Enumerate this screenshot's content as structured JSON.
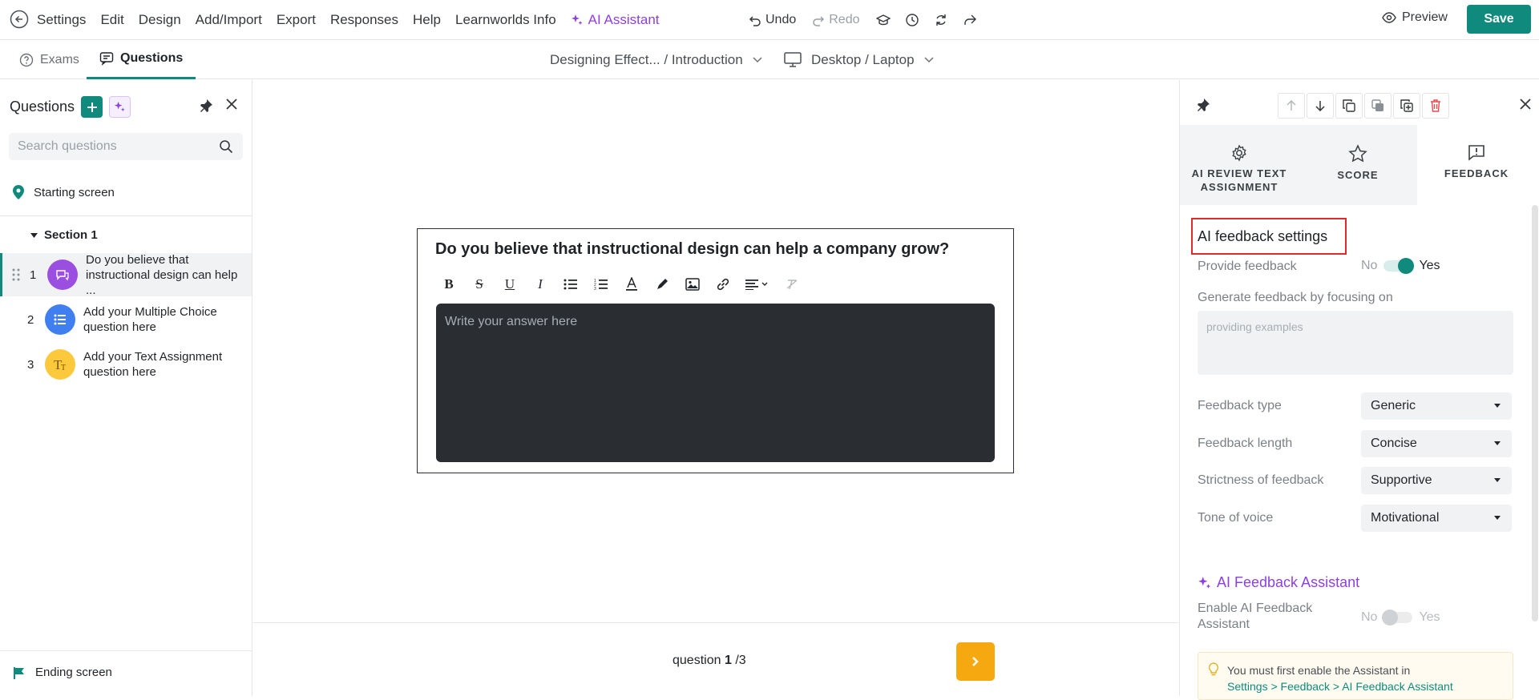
{
  "menu": {
    "items": [
      "Settings",
      "Edit",
      "Design",
      "Add/Import",
      "Export",
      "Responses",
      "Help",
      "Learnworlds Info"
    ],
    "ai_assistant": "AI Assistant"
  },
  "history": {
    "undo": "Undo",
    "redo": "Redo"
  },
  "header": {
    "preview": "Preview",
    "save": "Save"
  },
  "tabs": {
    "exams": "Exams",
    "questions": "Questions"
  },
  "breadcrumb": {
    "path": "Designing Effect... / Introduction",
    "device": "Desktop / Laptop"
  },
  "sidebar": {
    "title": "Questions",
    "search_placeholder": "Search questions",
    "starting_screen": "Starting screen",
    "section": "Section 1",
    "questions": [
      {
        "num": "1",
        "text": "Do you believe that instructional design can help ...",
        "color": "#9b4fe0",
        "icon": "text-assignment-icon"
      },
      {
        "num": "2",
        "text": "Add your Multiple Choice question here",
        "color": "#3f7fef",
        "icon": "list-icon"
      },
      {
        "num": "3",
        "text": "Add your Text Assignment question here",
        "color": "#fcc93d",
        "icon": "text-icon"
      }
    ],
    "ending_screen": "Ending screen"
  },
  "canvas": {
    "question": "Do you believe that instructional design can help a company grow?",
    "answer_placeholder": "Write your answer here",
    "count_label": "question",
    "count_current": "1",
    "count_total": "/3"
  },
  "panel": {
    "tabs": [
      "AI REVIEW TEXT ASSIGNMENT",
      "SCORE",
      "FEEDBACK"
    ],
    "section_title": "AI feedback settings",
    "provide_feedback": {
      "label": "Provide feedback",
      "no": "No",
      "yes": "Yes"
    },
    "focus": {
      "label": "Generate feedback by focusing on",
      "placeholder": "providing examples"
    },
    "settings": [
      {
        "label": "Feedback type",
        "value": "Generic"
      },
      {
        "label": "Feedback length",
        "value": "Concise"
      },
      {
        "label": "Strictness of feedback",
        "value": "Supportive"
      },
      {
        "label": "Tone of voice",
        "value": "Motivational"
      }
    ],
    "assistant": {
      "title": "AI Feedback Assistant",
      "enable_label": "Enable AI Feedback Assistant",
      "no": "No",
      "yes": "Yes",
      "notice": "You must first enable the Assistant in",
      "notice_link": "Settings > Feedback > AI Feedback Assistant"
    }
  },
  "colors": {
    "accent": "#0f8a7d",
    "ai": "#8e3fe0",
    "next": "#f5a80f",
    "highlight": "#e02b2b"
  }
}
